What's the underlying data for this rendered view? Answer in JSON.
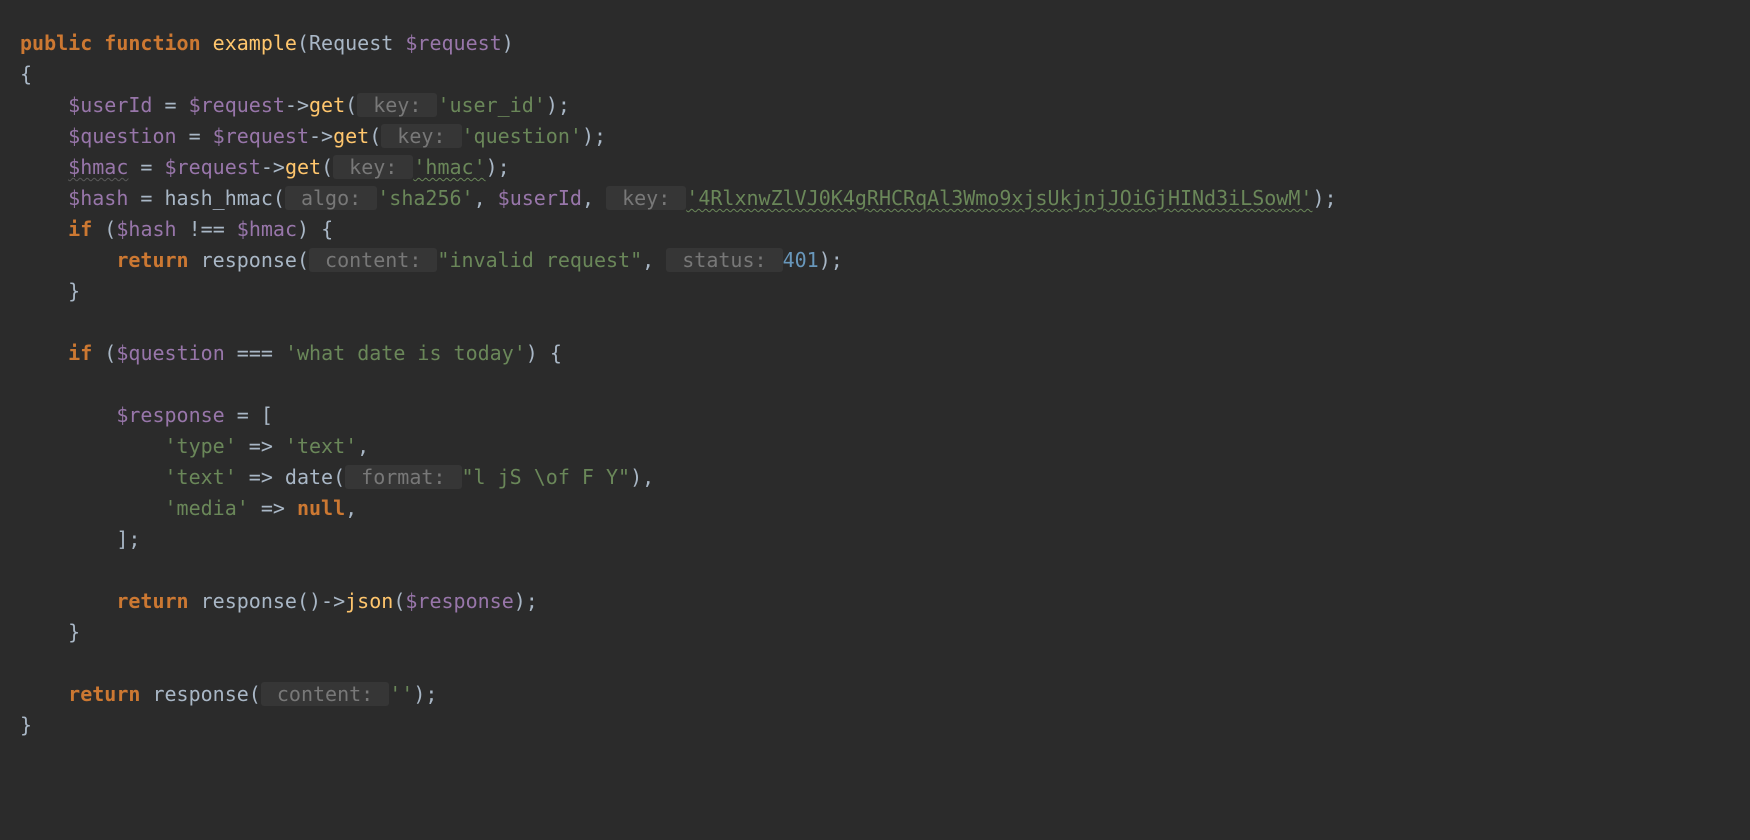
{
  "colors": {
    "background": "#2b2b2b",
    "keyword": "#cc7832",
    "function": "#ffc66d",
    "variable": "#9876aa",
    "string": "#6a8759",
    "number": "#6897bb",
    "hint_bg": "#363636",
    "hint_fg": "#787878",
    "default": "#a9b7c6"
  },
  "sig": {
    "public": "public",
    "function": "function",
    "name": "example",
    "lparen": "(",
    "param_type": "Request",
    "space1": " ",
    "param_var": "$request",
    "rparen_brace": ")",
    "open_brace": "{"
  },
  "line_userId": {
    "indent": "    ",
    "var": "$userId",
    "eq": " = ",
    "req": "$request",
    "arrow": "->",
    "method": "get",
    "lparen": "(",
    "hint": " key: ",
    "str": "'user_id'",
    "end": ");"
  },
  "line_question": {
    "indent": "    ",
    "var": "$question",
    "eq": " = ",
    "req": "$request",
    "arrow": "->",
    "method": "get",
    "lparen": "(",
    "hint": " key: ",
    "str": "'question'",
    "end": ");"
  },
  "line_hmac": {
    "indent": "    ",
    "var": "$hmac",
    "eq": " = ",
    "req": "$request",
    "arrow": "->",
    "method": "get",
    "lparen": "(",
    "hint": " key: ",
    "str": "'hmac'",
    "end": ");"
  },
  "line_hash": {
    "indent": "    ",
    "var": "$hash",
    "eq": " = ",
    "fn": "hash_hmac",
    "lparen": "(",
    "hint_algo": " algo: ",
    "str_algo": "'sha256'",
    "comma1": ", ",
    "data": "$userId",
    "comma2": ", ",
    "hint_key": " key: ",
    "str_key": "'4RlxnwZlVJ0K4gRHCRqAl3Wmo9xjsUkjnjJOiGjHINd3iLSowM'",
    "end": ");"
  },
  "line_if1": {
    "indent": "    ",
    "if": "if",
    "open": " (",
    "a": "$hash",
    "op": " !== ",
    "b": "$hmac",
    "close": ") {"
  },
  "line_return_invalid": {
    "indent": "        ",
    "return": "return",
    "sp": " ",
    "fn": "response",
    "lparen": "(",
    "hint_content": " content: ",
    "str": "\"invalid request\"",
    "comma": ", ",
    "hint_status": " status: ",
    "num": "401",
    "end": ");"
  },
  "close_brace_1": {
    "indent": "    ",
    "brace": "}"
  },
  "blank": "",
  "line_if2": {
    "indent": "    ",
    "if": "if",
    "open": " (",
    "a": "$question",
    "op": " === ",
    "str": "'what date is today'",
    "close": ") {"
  },
  "line_resp_open": {
    "indent": "        ",
    "var": "$response",
    "eq": " = [",
    "end": ""
  },
  "line_arr_type": {
    "indent": "            ",
    "key": "'type'",
    "arrow": " => ",
    "val": "'text'",
    "comma": ","
  },
  "line_arr_text": {
    "indent": "            ",
    "key": "'text'",
    "arrow": " => ",
    "fn": "date",
    "lparen": "(",
    "hint": " format: ",
    "str": "\"l jS \\of F Y\"",
    "end": "),"
  },
  "line_arr_media": {
    "indent": "            ",
    "key": "'media'",
    "arrow": " => ",
    "null": "null",
    "comma": ","
  },
  "line_resp_close": {
    "indent": "        ",
    "txt": "];"
  },
  "line_return_json": {
    "indent": "        ",
    "return": "return",
    "sp": " ",
    "fn": "response",
    "paren": "()",
    "arrow": "->",
    "json": "json",
    "lparen": "(",
    "var": "$response",
    "end": ");"
  },
  "close_brace_2": {
    "indent": "    ",
    "brace": "}"
  },
  "line_return_empty": {
    "indent": "    ",
    "return": "return",
    "sp": " ",
    "fn": "response",
    "lparen": "(",
    "hint": " content: ",
    "str": "''",
    "end": ");"
  },
  "close_brace_3": {
    "brace": "}"
  }
}
